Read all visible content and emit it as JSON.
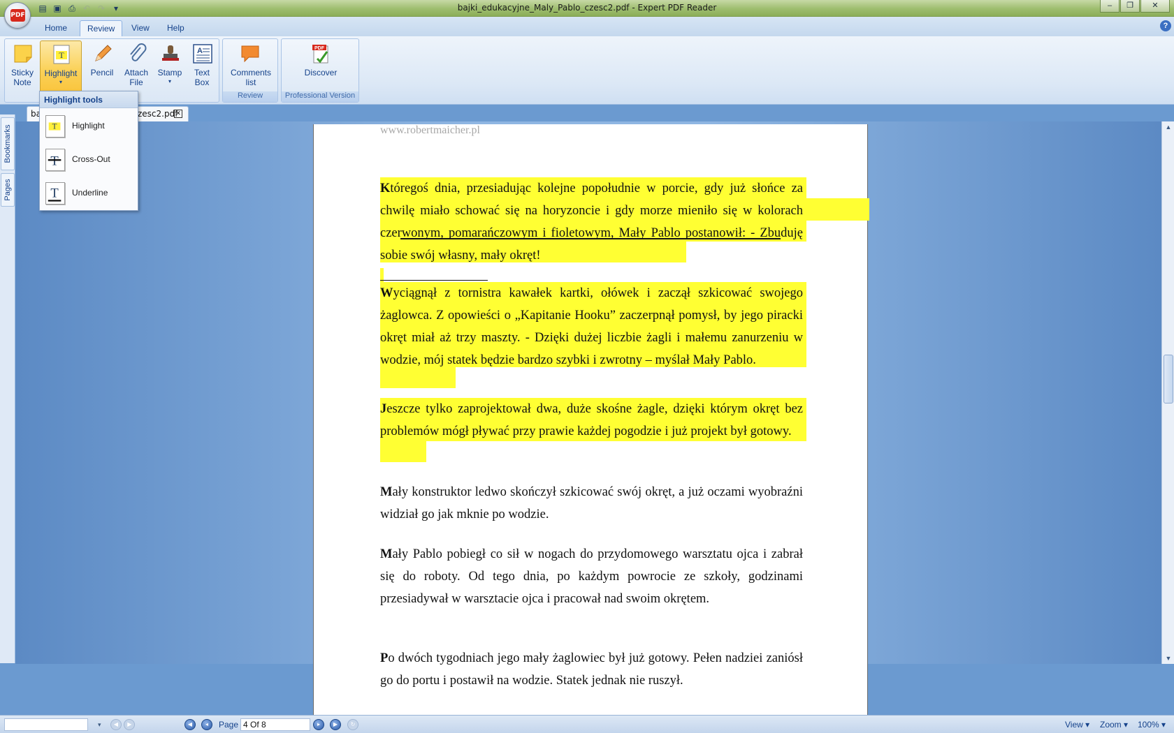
{
  "window": {
    "title": "bajki_edukacyjne_Maly_Pablo_czesc2.pdf - Expert PDF Reader",
    "logo_text": "PDF"
  },
  "menu": {
    "tabs": [
      "Home",
      "Review",
      "View",
      "Help"
    ],
    "active_tab": "Review"
  },
  "ribbon": {
    "group1_buttons": [
      "Sticky\nNote",
      "Highlight",
      "Pencil",
      "Attach\nFile",
      "Stamp",
      "Text\nBox"
    ],
    "review_group": {
      "label": "Review",
      "button": "Comments\nlist"
    },
    "pro_group": {
      "label": "Professional Version",
      "button": "Discover"
    }
  },
  "highlight_menu": {
    "header": "Highlight tools",
    "items": [
      "Highlight",
      "Cross-Out",
      "Underline"
    ]
  },
  "sidebar": {
    "tabs": [
      "Bookmarks",
      "Pages"
    ]
  },
  "document_tab": {
    "prefix": "ba",
    "suffix": "zesc2.pdf"
  },
  "page": {
    "website": "www.robertmaicher.pl",
    "paragraphs": [
      {
        "first": "K",
        "rest": "tóregoś dnia, przesiadując kolejne popołudnie w porcie, gdy już słońce za chwilę miało schować się na horyzoncie i gdy morze mieniło się w kolorach czerwonym, pomarańczowym i fioletowym, Mały Pablo postanowił: - Zbuduję sobie swój własny, mały okręt!"
      },
      {
        "first": "W",
        "rest": "yciągnął z tornistra kawałek kartki, ołówek i zaczął szkicować swojego żaglowca. Z opowieści o „Kapitanie Hooku” zaczerpnął pomysł, by jego piracki okręt miał aż trzy maszty. - Dzięki dużej liczbie żagli i małemu zanurzeniu w wodzie, mój statek będzie bardzo szybki i zwrotny – myślał Mały Pablo."
      },
      {
        "first": "J",
        "rest": "eszcze tylko zaprojektował dwa, duże skośne żagle, dzięki którym okręt bez problemów mógł pływać przy prawie każdej pogodzie i już projekt był gotowy."
      },
      {
        "first": "M",
        "rest": "ały konstruktor ledwo skończył szkicować swój okręt, a już oczami wyobraźni widział go jak mknie po wodzie."
      },
      {
        "first": "M",
        "rest": "ały Pablo pobiegł co sił w nogach do przydomowego warsztatu ojca i zabrał się do roboty. Od tego dnia, po każdym powrocie ze szkoły, godzinami przesiadywał w warsztacie ojca i pracował nad swoim okrętem."
      },
      {
        "first": "P",
        "rest": "o dwóch tygodniach jego mały żaglowiec był już gotowy. Pełen nadziei zaniósł go do portu i postawił na wodzie. Statek jednak nie ruszył."
      }
    ]
  },
  "statusbar": {
    "page_label": "Page",
    "page_value": "4 Of 8",
    "view_label": "View",
    "zoom_label": "Zoom",
    "zoom_value": "100%"
  },
  "colors": {
    "highlight": "#ffff33",
    "accent": "#15428b"
  }
}
